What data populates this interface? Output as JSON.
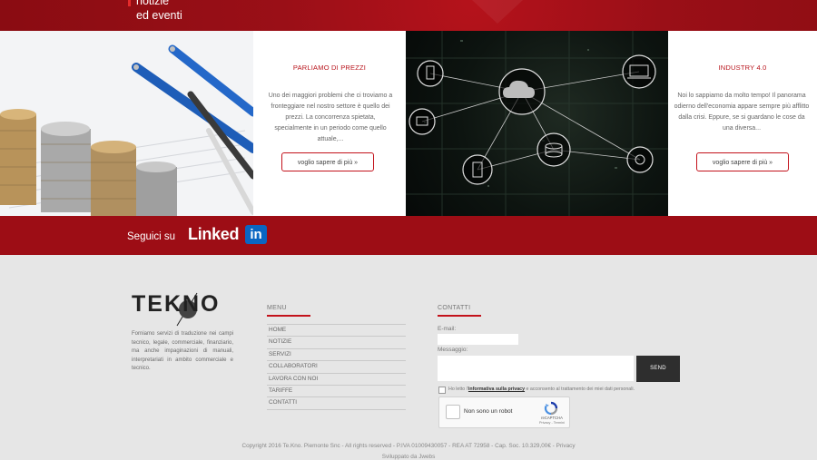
{
  "top_banner": {
    "line1": "notizie",
    "line2": "ed eventi",
    "background_color": "#9d0d15"
  },
  "cards": [
    {
      "image_icon": "coins-and-pens-photo",
      "title": "PARLIAMO DI PREZZI",
      "description": "Uno dei maggiori problemi che ci troviamo a fronteggiare nel nostro settore è quello dei prezzi. La concorrenza spietata, specialmente in un periodo come quello attuale,...",
      "button_label": "voglio sapere di più »"
    },
    {
      "image_icon": "network-cloud-photo",
      "title": "INDUSTRY 4.0",
      "description": "Noi lo sappiamo da molto tempo! Il panorama odierno dell'economia appare sempre più afflitto dalla crisi. Eppure, se si guardano le cose da una diversa...",
      "button_label": "voglio sapere di più »"
    }
  ],
  "social": {
    "label": "Seguici su",
    "brand_word": "Linked",
    "brand_box": "in",
    "brand_color": "#0a66c2"
  },
  "footer": {
    "logo_text": "TEKNO",
    "about": "Forniamo servizi di traduzione nei campi tecnico, legale, commerciale, finanziario, ma anche impaginazioni di manuali, interpretariati in ambito commerciale e tecnico.",
    "menu": {
      "heading": "MENU",
      "items": [
        "HOME",
        "NOTIZIE",
        "SERVIZI",
        "COLLABORATORI",
        "LAVORA CON NOI",
        "TARIFFE",
        "CONTATTI"
      ]
    },
    "contact": {
      "heading": "CONTATTI",
      "email_label": "E-mail:",
      "email_value": "",
      "message_label": "Messaggio:",
      "message_value": "",
      "send_label": "SEND",
      "privacy_prefix": "Ho letto l'",
      "privacy_link": "informativa sulla privacy",
      "privacy_suffix": " e acconsento al trattamento dei miei dati personali.",
      "recaptcha_label": "Non sono un robot",
      "recaptcha_brand": "reCAPTCHA",
      "recaptcha_terms": "Privacy - Termini"
    },
    "copyright": "Copyright 2016 Te.Kno. Piemonte Snc - All rights reserved - P.IVA 01009430057 - REA AT 72958 - Cap. Soc. 10.329,00€ - Privacy",
    "developer": "Sviluppato da Jwebs",
    "accent_color": "#c3121b"
  }
}
